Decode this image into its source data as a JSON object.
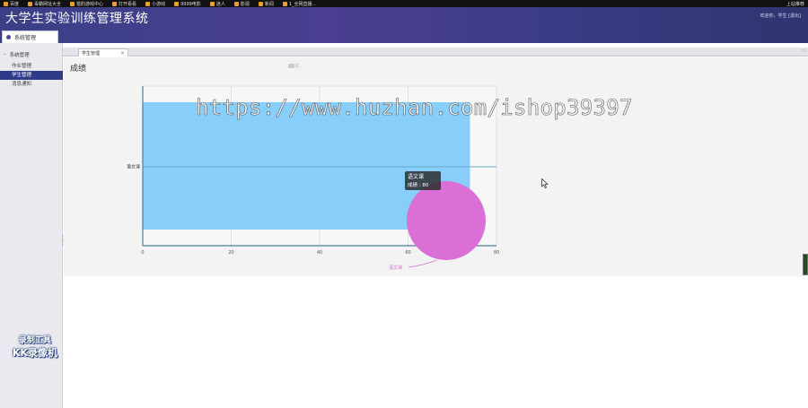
{
  "browser": {
    "bookmarks": [
      "百度",
      "毒霸网址大全",
      "猎豹游戏中心",
      "打开看看",
      "小游戏",
      "9999电影",
      "迷人",
      "影视",
      "新闻",
      "1_全网直播..."
    ],
    "right_label": "上站推荐"
  },
  "header": {
    "title": "大学生实验训练管理系统",
    "welcome": "欢迎你，学生 [退出]"
  },
  "sidebar": {
    "head_label": "系统管理",
    "group_label": "系统管理",
    "items": [
      {
        "label": "作业管理",
        "active": false
      },
      {
        "label": "学生管理",
        "active": true
      },
      {
        "label": "消息通知",
        "active": false
      }
    ]
  },
  "tabs": [
    {
      "label": "学生管理"
    }
  ],
  "page": {
    "heading": "成绩"
  },
  "chart_data": {
    "type": "bar",
    "orientation": "horizontal",
    "categories": [
      "语文课"
    ],
    "values": [
      74
    ],
    "xlim": [
      0,
      80
    ],
    "xticks": [
      0,
      20,
      40,
      60,
      80
    ],
    "bar_color": "#87cefa",
    "grid": true,
    "tooltip": {
      "line1": "语文课",
      "line2": "成绩 : 80"
    },
    "pie_label": "语文课",
    "pie_color": "#da70d6",
    "legend_label": "成..."
  },
  "overlay": {
    "watermark": "https://www.huzhan.com/ishop39397",
    "rec_line1": "录制工具",
    "rec_line2": "KK录像机"
  }
}
